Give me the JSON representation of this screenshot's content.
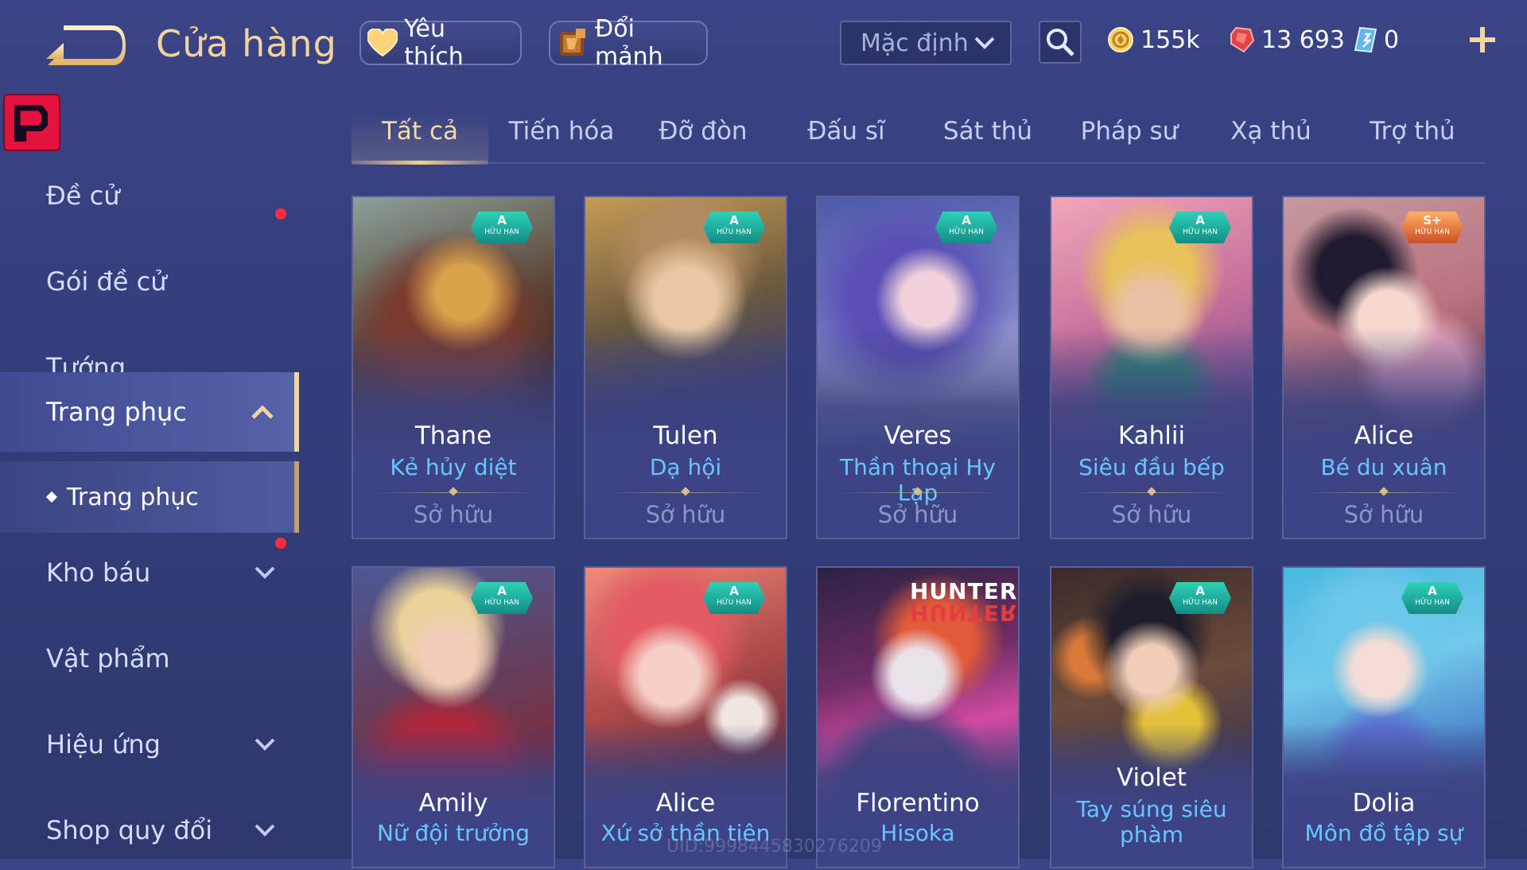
{
  "header": {
    "title": "Cửa hàng",
    "favorite_label": "Yêu thích",
    "shard_label": "Đổi mảnh",
    "sort_value": "Mặc định",
    "currencies": {
      "gold": "155k",
      "ruby": "13 693",
      "voucher": "0"
    }
  },
  "sidebar": {
    "items": [
      {
        "label": "Đề cử"
      },
      {
        "label": "Gói đề cử"
      },
      {
        "label": "Tướng"
      },
      {
        "label": "Trang phục"
      },
      {
        "label": "Trang phục"
      },
      {
        "label": "Kho báu"
      },
      {
        "label": "Vật phẩm"
      },
      {
        "label": "Hiệu ứng"
      },
      {
        "label": "Shop quy đổi"
      }
    ]
  },
  "tabs": [
    "Tất cả",
    "Tiến hóa",
    "Đỡ đòn",
    "Đấu sĩ",
    "Sát thủ",
    "Pháp sư",
    "Xạ thủ",
    "Trợ thủ"
  ],
  "cards": [
    {
      "hero": "Thane",
      "skin": "Kẻ hủy diệt",
      "status": "Sở hữu",
      "tier": "A",
      "tag": "HỮU HẠN"
    },
    {
      "hero": "Tulen",
      "skin": "Dạ hội",
      "status": "Sở hữu",
      "tier": "A",
      "tag": "HỮU HẠN"
    },
    {
      "hero": "Veres",
      "skin": "Thần thoại Hy Lạp",
      "status": "Sở hữu",
      "tier": "A",
      "tag": "HỮU HẠN"
    },
    {
      "hero": "Kahlii",
      "skin": "Siêu đầu bếp",
      "status": "Sở hữu",
      "tier": "A",
      "tag": "HỮU HẠN"
    },
    {
      "hero": "Alice",
      "skin": "Bé du xuân",
      "status": "Sở hữu",
      "tier": "S+",
      "tag": "HỮU HẠN"
    },
    {
      "hero": "Amily",
      "skin": "Nữ đội trưởng",
      "tier": "A",
      "tag": "HỮU HẠN"
    },
    {
      "hero": "Alice",
      "skin": "Xứ sở thần tiên",
      "tier": "A",
      "tag": "HỮU HẠN"
    },
    {
      "hero": "Florentino",
      "skin": "Hisoka",
      "collab": "HUNTER",
      "collab_mirror": "HUNTER"
    },
    {
      "hero": "Violet",
      "skin": "Tay súng siêu phàm",
      "tier": "A",
      "tag": "HỮU HẠN"
    },
    {
      "hero": "Dolia",
      "skin": "Môn đồ tập sự",
      "tier": "A",
      "tag": "HỮU HẠN"
    }
  ],
  "footer": {
    "uid": "UID:9998445830276209"
  },
  "colors": {
    "accent": "#f0d59a",
    "skin_name": "#67c6ff",
    "notify_dot": "#ff2d3c"
  },
  "icons": [
    "back-arrow-icon",
    "heart-icon",
    "shard-icon",
    "chevron-down-icon",
    "search-icon",
    "gold-coin-icon",
    "ruby-icon",
    "voucher-icon",
    "plus-icon",
    "chevron-up-icon"
  ]
}
